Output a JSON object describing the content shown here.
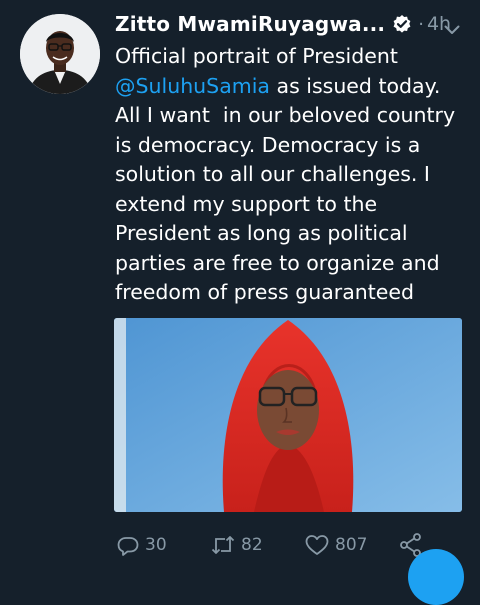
{
  "tweet": {
    "author_name": "Zitto MwamiRuyagwa...",
    "separator": "·",
    "time": "4h",
    "text_before": "Official portrait of President\n",
    "mention": "@SuluhuSamia",
    "text_after": " as issued today.\nAll I want  in our beloved country\nis democracy. Democracy is a\nsolution to all our challenges. I\nextend my support to the\nPresident as long as political\nparties are free to organize and\nfreedom of press guaranteed"
  },
  "actions": {
    "reply_count": "30",
    "retweet_count": "82",
    "like_count": "807"
  },
  "icons": {
    "verified": "verified-badge-icon",
    "caret": "chevron-down-icon",
    "reply": "reply-icon",
    "retweet": "retweet-icon",
    "like": "heart-icon",
    "share": "share-icon"
  },
  "colors": {
    "background": "#15202b",
    "text": "#ffffff",
    "secondary": "#8899a6",
    "accent": "#1da1f2"
  }
}
